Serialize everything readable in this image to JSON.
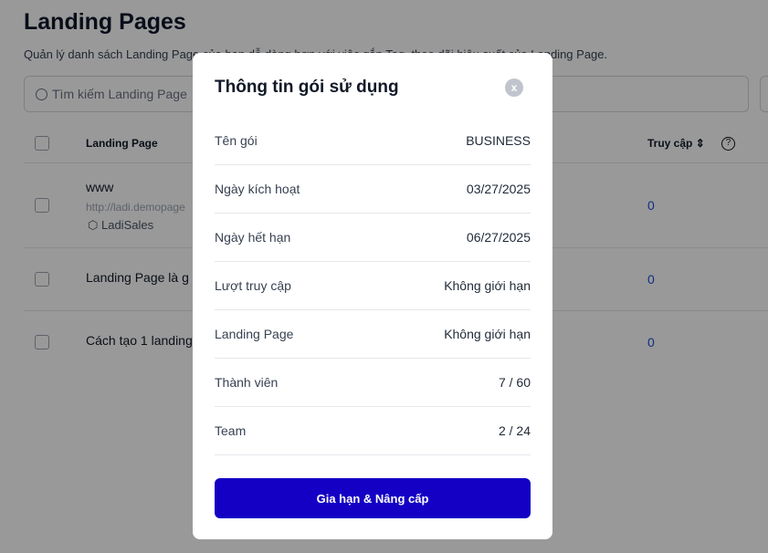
{
  "page": {
    "title": "Landing Pages",
    "subtitle": "Quản lý danh sách Landing Page của bạn dễ dàng hơn với việc gắn Tag, theo dõi hiệu suất của Landing Page.",
    "search_placeholder": "Tìm kiếm Landing Page"
  },
  "table": {
    "headers": {
      "name": "Landing Page",
      "visits": "Truy cập"
    },
    "rows": [
      {
        "name": "www",
        "url": "http://ladi.demopage",
        "tag": "LadiSales",
        "visits": "0"
      },
      {
        "name": "Landing Page là g",
        "visits": "0"
      },
      {
        "name": "Cách tạo 1 landing",
        "visits": "0"
      }
    ]
  },
  "modal": {
    "title": "Thông tin gói sử dụng",
    "close": "x",
    "rows": [
      {
        "label": "Tên gói",
        "value": "BUSINESS"
      },
      {
        "label": "Ngày kích hoạt",
        "value": "03/27/2025"
      },
      {
        "label": "Ngày hết hạn",
        "value": "06/27/2025"
      },
      {
        "label": "Lượt truy cập",
        "value": "Không giới hạn"
      },
      {
        "label": "Landing Page",
        "value": "Không giới hạn"
      },
      {
        "label": "Thành viên",
        "value": "7 / 60"
      },
      {
        "label": "Team",
        "value": "2 / 24"
      }
    ],
    "button": "Gia hạn & Nâng cấp"
  }
}
